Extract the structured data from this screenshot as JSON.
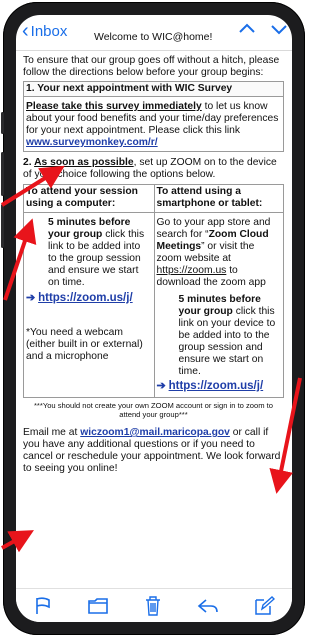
{
  "nav": {
    "back_label": "Inbox",
    "title": "Welcome to WIC@home!",
    "prev_arrow": "^",
    "next_arrow": "v"
  },
  "intro": "To ensure that our group goes off without a hitch, please follow the directions below before your group begins:",
  "step1": {
    "heading": "1. Your next appointment with WIC Survey",
    "lead": "Please take this survey immediately",
    "text": " to let us know about your food benefits and your time/day preferences for your next appointment. Please click this link ",
    "link": "www.surveymonkey.com/r/"
  },
  "step2": {
    "number": "2. ",
    "lead": "As soon as possible",
    "text": ", set up ZOOM on to the device of your choice following the options below."
  },
  "computer": {
    "heading": "To attend your session using a computer:",
    "bold": "5 minutes before your group",
    "text": " click this link to be added into to the group session and ensure we start on time.",
    "link": "https://zoom.us/j/",
    "note": "*You need a webcam (either built in or external) and a microphone"
  },
  "phone": {
    "heading": "To attend using a smartphone or tablet:",
    "text1": "Go to your app store and search for “",
    "app_name": "Zoom Cloud Meetings",
    "text2": "” or visit the zoom website at ",
    "site": "https://zoom.us",
    "text3": " to download the zoom app",
    "bold": "5 minutes before your group",
    "text4": " click this link on your device to be added into to the group session and ensure we start on time.",
    "link": "https://zoom.us/j/"
  },
  "disclaimer": "***You should not create your own ZOOM account or sign in to zoom to attend your group***",
  "footer": {
    "text1": "Email me at ",
    "email": "wiczoom1@mail.maricopa.gov",
    "text2": " or call if you have any additional questions or if you need to cancel or reschedule your appointment. We look forward to seeing you online!"
  },
  "colors": {
    "ios_blue": "#1a6ee8",
    "link_blue": "#1f3ea8",
    "annotation_red": "#e8141b"
  },
  "toolbar_icons": [
    "flag-icon",
    "folder-icon",
    "trash-icon",
    "reply-icon",
    "compose-icon"
  ]
}
